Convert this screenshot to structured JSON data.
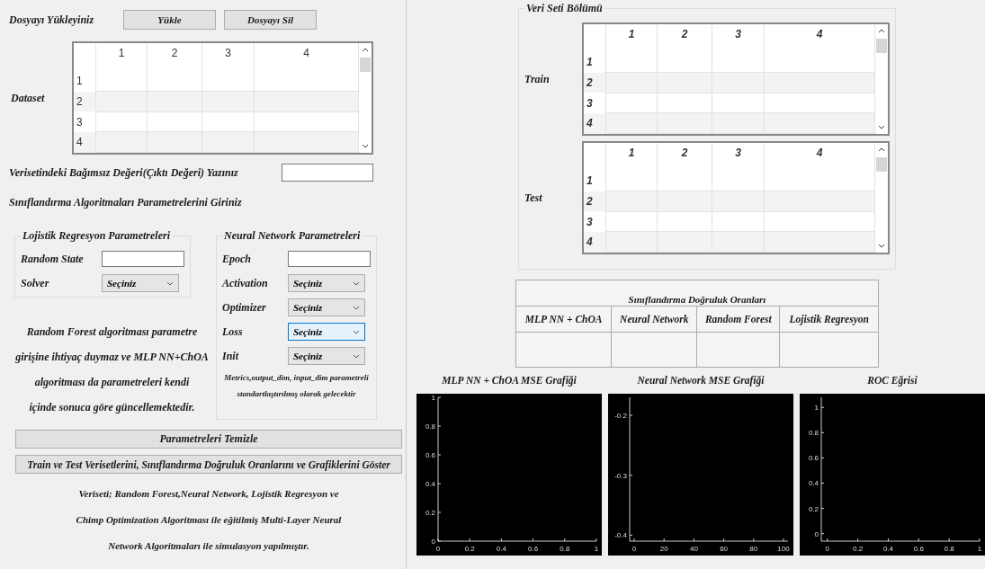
{
  "upload": {
    "label": "Dosyayı Yükleyiniz",
    "buttons": [
      "Yükle",
      "Dosyayı Sil"
    ]
  },
  "dataset": {
    "label": "Dataset",
    "columns": [
      "1",
      "2",
      "3",
      "4"
    ],
    "rows": [
      "1",
      "2",
      "3",
      "4"
    ]
  },
  "output_field": {
    "label": "Verisetindeki Bağımsız Değeri(Çıktı Değeri) Yazınız"
  },
  "params_heading": "Sınıflandırma Algoritmaları Parametrelerini Giriniz",
  "logistic": {
    "title": "Lojistik Regresyon Parametreleri",
    "fields": [
      {
        "kind": "input",
        "label": "Random State"
      },
      {
        "kind": "select",
        "label": "Solver",
        "value": "Seçiniz",
        "focused": false
      }
    ]
  },
  "random_forest_note": [
    "Random Forest algoritması parametre",
    "girişine ihtiyaç duymaz ve MLP NN+ChOA",
    "algoritması da parametreleri kendi",
    "içinde sonuca göre güncellemektedir."
  ],
  "neural": {
    "title": "Neural Network Parametreleri",
    "fields": [
      {
        "kind": "input",
        "label": "Epoch"
      },
      {
        "kind": "select",
        "label": "Activation",
        "value": "Seçiniz",
        "focused": false
      },
      {
        "kind": "select",
        "label": "Optimizer",
        "value": "Seçiniz",
        "focused": false
      },
      {
        "kind": "select",
        "label": "Loss",
        "value": "Seçiniz",
        "focused": true
      },
      {
        "kind": "select",
        "label": "Init",
        "value": "Seçiniz",
        "focused": false
      }
    ],
    "note": [
      "Metrics,output_dim, input_dim parametreli",
      "standartlaştırılmış olarak gelecektir"
    ]
  },
  "buttons": [
    "Parametreleri Temizle",
    "Train ve Test Verisetlerini, Sınıflandırma Doğruluk Oranlarını ve Grafiklerini Göster"
  ],
  "footer": [
    "Veriseti; Random Forest,Neural Network, Lojistik Regresyon ve",
    "Chimp Optimization Algoritması ile eğitilmiş Multi-Layer Neural",
    "Network Algoritmaları ile simulasyon yapılmıştır."
  ],
  "split": {
    "title": "Veri Seti Bölümü",
    "tables": [
      {
        "label": "Train",
        "columns": [
          "1",
          "2",
          "3",
          "4"
        ],
        "rows": [
          "1",
          "2",
          "3",
          "4"
        ]
      },
      {
        "label": "Test",
        "columns": [
          "1",
          "2",
          "3",
          "4"
        ],
        "rows": [
          "1",
          "2",
          "3",
          "4"
        ]
      }
    ]
  },
  "accuracy": {
    "title": "Sınıflandırma Doğruluk Oranları",
    "columns": [
      "MLP NN + ChOA",
      "Neural Network",
      "Random Forest",
      "Lojistik Regresyon"
    ]
  },
  "charts": [
    {
      "title": "MLP NN + ChOA MSE Grafiği",
      "chart_data": {
        "type": "line",
        "xlim": [
          0,
          1
        ],
        "ylim": [
          0,
          1
        ],
        "xticks": [
          0,
          0.2,
          0.4,
          0.6,
          0.8,
          1
        ],
        "yticks": [
          0,
          0.2,
          0.4,
          0.6,
          0.8,
          1
        ]
      }
    },
    {
      "title": "Neural Network MSE Grafiği",
      "chart_data": {
        "type": "line",
        "xlim": [
          -3,
          103
        ],
        "ylim": [
          -0.41,
          -0.17
        ],
        "xticks": [
          0,
          20,
          40,
          60,
          80,
          100
        ],
        "yticks": [
          -0.4,
          -0.3,
          -0.2
        ]
      }
    },
    {
      "title": "ROC Eğrisi",
      "chart_data": {
        "type": "line",
        "xlim": [
          -0.04,
          1.0
        ],
        "ylim": [
          -0.06,
          1.08
        ],
        "xticks": [
          0,
          0.2,
          0.4,
          0.6,
          0.8,
          1
        ],
        "yticks": [
          0,
          0.2,
          0.4,
          0.6,
          0.8,
          1
        ]
      }
    }
  ]
}
